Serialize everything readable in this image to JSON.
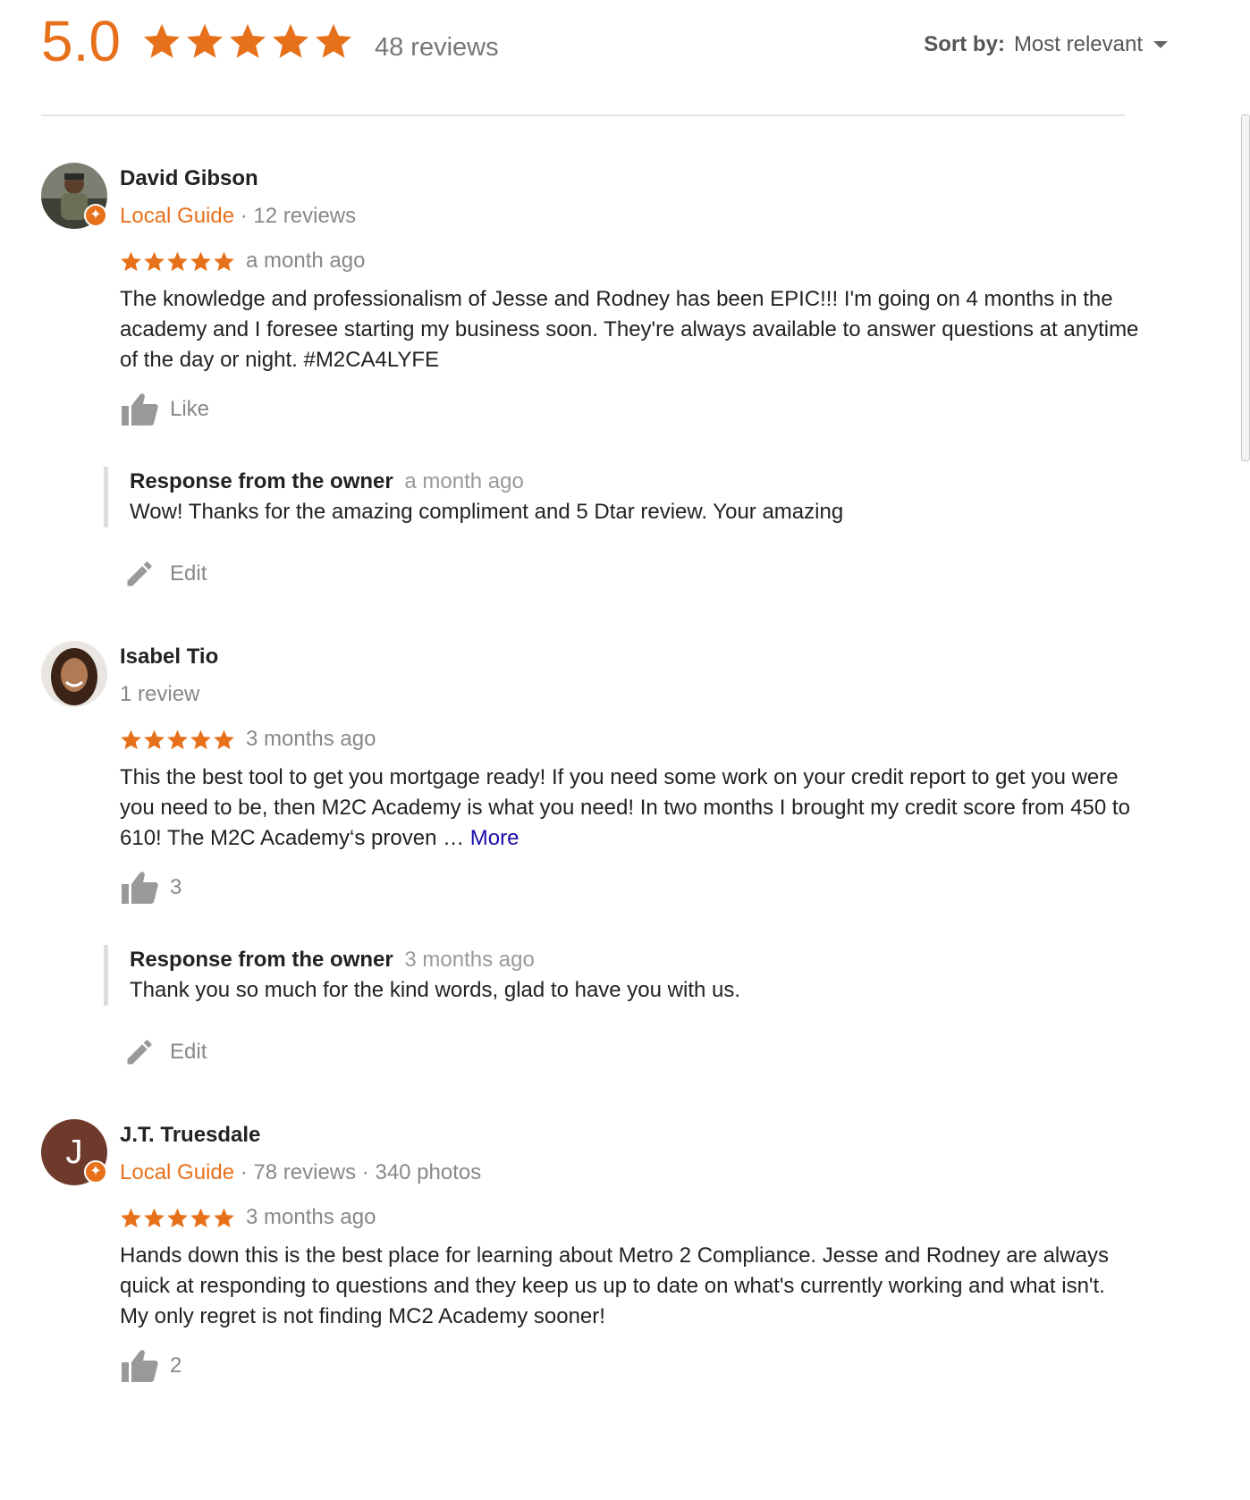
{
  "summary": {
    "rating": "5.0",
    "stars": 5,
    "review_count": "48 reviews",
    "star_color": "#e7711b"
  },
  "sort": {
    "label": "Sort by:",
    "value": "Most relevant"
  },
  "reviews": [
    {
      "name": "David Gibson",
      "guide_label": "Local Guide",
      "meta": "· 12 reviews",
      "stars": 5,
      "time": "a month ago",
      "text": "The knowledge and professionalism of Jesse and Rodney has been EPIC!!! I'm going on 4 months in the academy and I foresee starting my business soon. They're always available to answer questions at anytime of the day or night. #M2CA4LYFE",
      "like": "Like",
      "owner_label": "Response from the owner",
      "owner_time": "a month ago",
      "owner_text": "Wow! Thanks for the amazing compliment and 5 Dtar review. Your amazing",
      "edit": "Edit"
    },
    {
      "name": "Isabel Tio",
      "meta": "1 review",
      "stars": 5,
      "time": "3 months ago",
      "text": "This the best tool to get you mortgage ready! If you need some work on your credit report to get you were you need to be, then M2C Academy is what you need! In two months I brought my credit score from 450 to 610!  The M2C Academy‘s proven …",
      "more": "More",
      "like": "3",
      "owner_label": "Response from the owner",
      "owner_time": "3 months ago",
      "owner_text": "Thank you so much for the kind words, glad to have you with us.",
      "edit": "Edit"
    },
    {
      "name": "J.T. Truesdale",
      "avatar_letter": "J",
      "guide_label": "Local Guide",
      "meta": "· 78 reviews · 340 photos",
      "stars": 5,
      "time": "3 months ago",
      "text": "Hands down this is the best place for learning about Metro 2 Compliance. Jesse and Rodney are always quick at responding to questions and they keep us up to date on what's currently working and what isn't. My only regret is not finding MC2 Academy sooner!",
      "like": "2"
    }
  ]
}
